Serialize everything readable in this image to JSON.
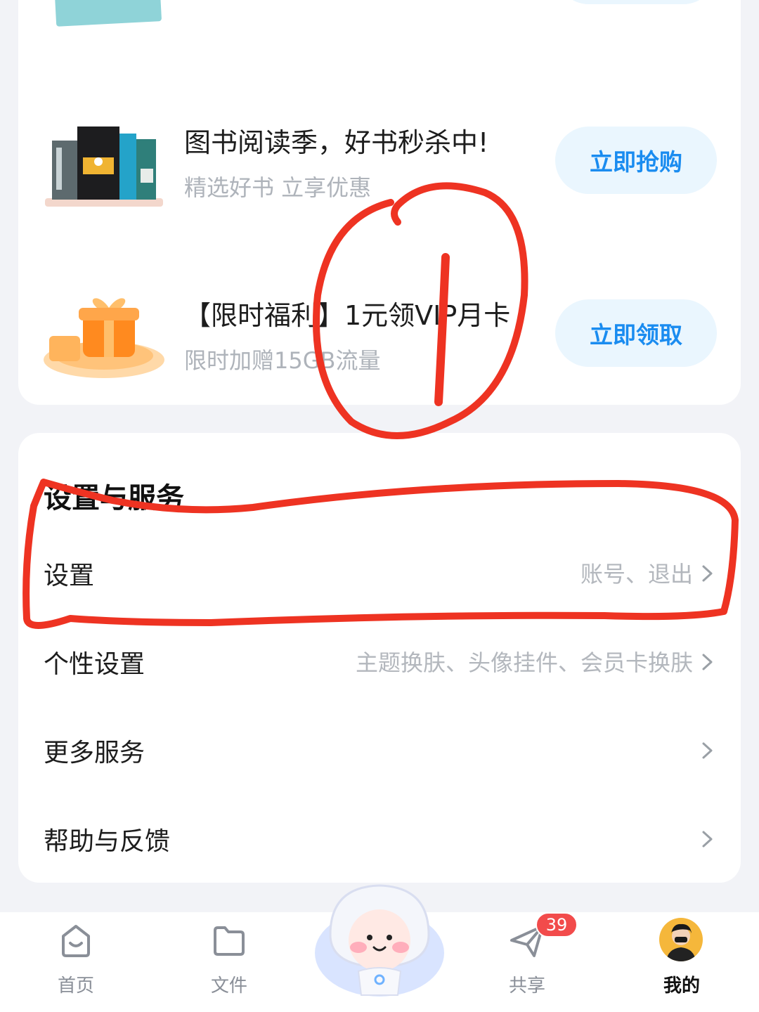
{
  "promos": [
    {
      "title": "图书阅读季，好书秒杀中!",
      "subtitle": "精选好书 立享优惠",
      "button": "立即抢购"
    },
    {
      "title": "【限时福利】1元领VIP月卡",
      "subtitle": "限时加赠15GB流量",
      "button": "立即领取"
    }
  ],
  "settings": {
    "section_title": "设置与服务",
    "rows": [
      {
        "label": "设置",
        "hint": "账号、退出"
      },
      {
        "label": "个性设置",
        "hint": "主题换肤、头像挂件、会员卡换肤"
      },
      {
        "label": "更多服务",
        "hint": ""
      },
      {
        "label": "帮助与反馈",
        "hint": ""
      }
    ]
  },
  "tabbar": {
    "tabs": [
      {
        "label": "首页",
        "icon": "home-icon"
      },
      {
        "label": "文件",
        "icon": "folder-icon"
      },
      {
        "label": "共享",
        "icon": "share-icon",
        "badge": "39"
      },
      {
        "label": "我的",
        "icon": "avatar"
      }
    ]
  },
  "colors": {
    "accent": "#1a8cf0",
    "annotation": "#ee3322",
    "badge": "#f24b4b"
  }
}
